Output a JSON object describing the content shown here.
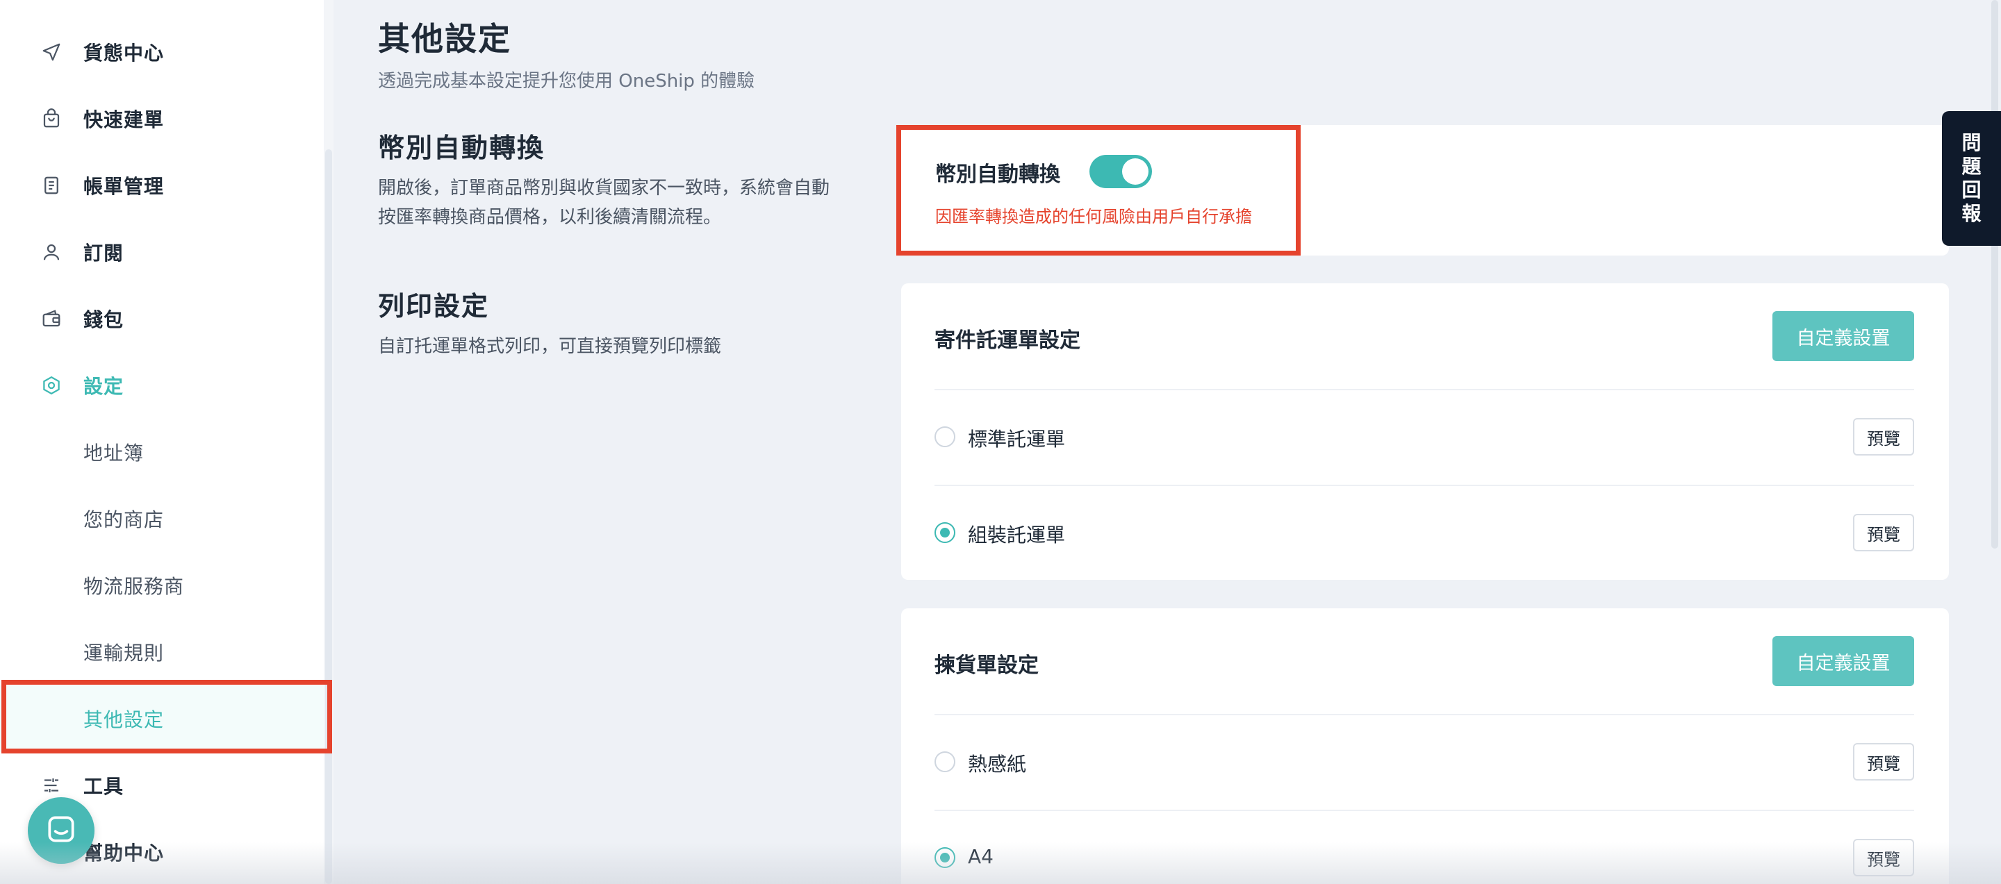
{
  "sidebar": {
    "items": [
      {
        "label": "貨態中心",
        "icon": "send-icon"
      },
      {
        "label": "快速建單",
        "icon": "shopping-bag-icon"
      },
      {
        "label": "帳單管理",
        "icon": "bill-icon"
      },
      {
        "label": "訂閱",
        "icon": "user-icon"
      },
      {
        "label": "錢包",
        "icon": "wallet-icon"
      },
      {
        "label": "設定",
        "icon": "settings-icon"
      },
      {
        "label": "地址簿"
      },
      {
        "label": "您的商店"
      },
      {
        "label": "物流服務商"
      },
      {
        "label": "運輸規則"
      },
      {
        "label": "其他設定"
      },
      {
        "label": "工具",
        "icon": "tools-icon"
      },
      {
        "label": "幫助中心",
        "icon": "help-icon"
      }
    ]
  },
  "header": {
    "title": "其他設定",
    "subtitle": "透過完成基本設定提升您使用 OneShip 的體驗"
  },
  "currency": {
    "section_title": "幣別自動轉換",
    "section_desc_line1": "開啟後，訂單商品幣別與收貨國家不一致時，系統會自動",
    "section_desc_line2": "按匯率轉換商品價格，以利後續清關流程。",
    "toggle_label": "幣別自動轉換",
    "toggle_on": true,
    "warning": "因匯率轉換造成的任何風險由用戶自行承擔"
  },
  "print": {
    "section_title": "列印設定",
    "section_desc": "自訂托運單格式列印，可直接預覽列印標籤",
    "shipping_card": {
      "title": "寄件託運單設定",
      "custom_button": "自定義設置",
      "options": [
        {
          "label": "標準託運單",
          "checked": false,
          "preview": "預覽"
        },
        {
          "label": "組裝託運單",
          "checked": true,
          "preview": "預覽"
        }
      ]
    },
    "picking_card": {
      "title": "揀貨單設定",
      "custom_button": "自定義設置",
      "options": [
        {
          "label": "熱感紙",
          "checked": false,
          "preview": "預覽"
        },
        {
          "label": "A4",
          "checked": true,
          "preview": "預覽"
        }
      ]
    }
  },
  "feedback": {
    "chars": [
      "問",
      "題",
      "回",
      "報"
    ]
  },
  "colors": {
    "accent": "#3db9b3",
    "highlight": "#e5432d",
    "dark": "#0f1a2b"
  }
}
